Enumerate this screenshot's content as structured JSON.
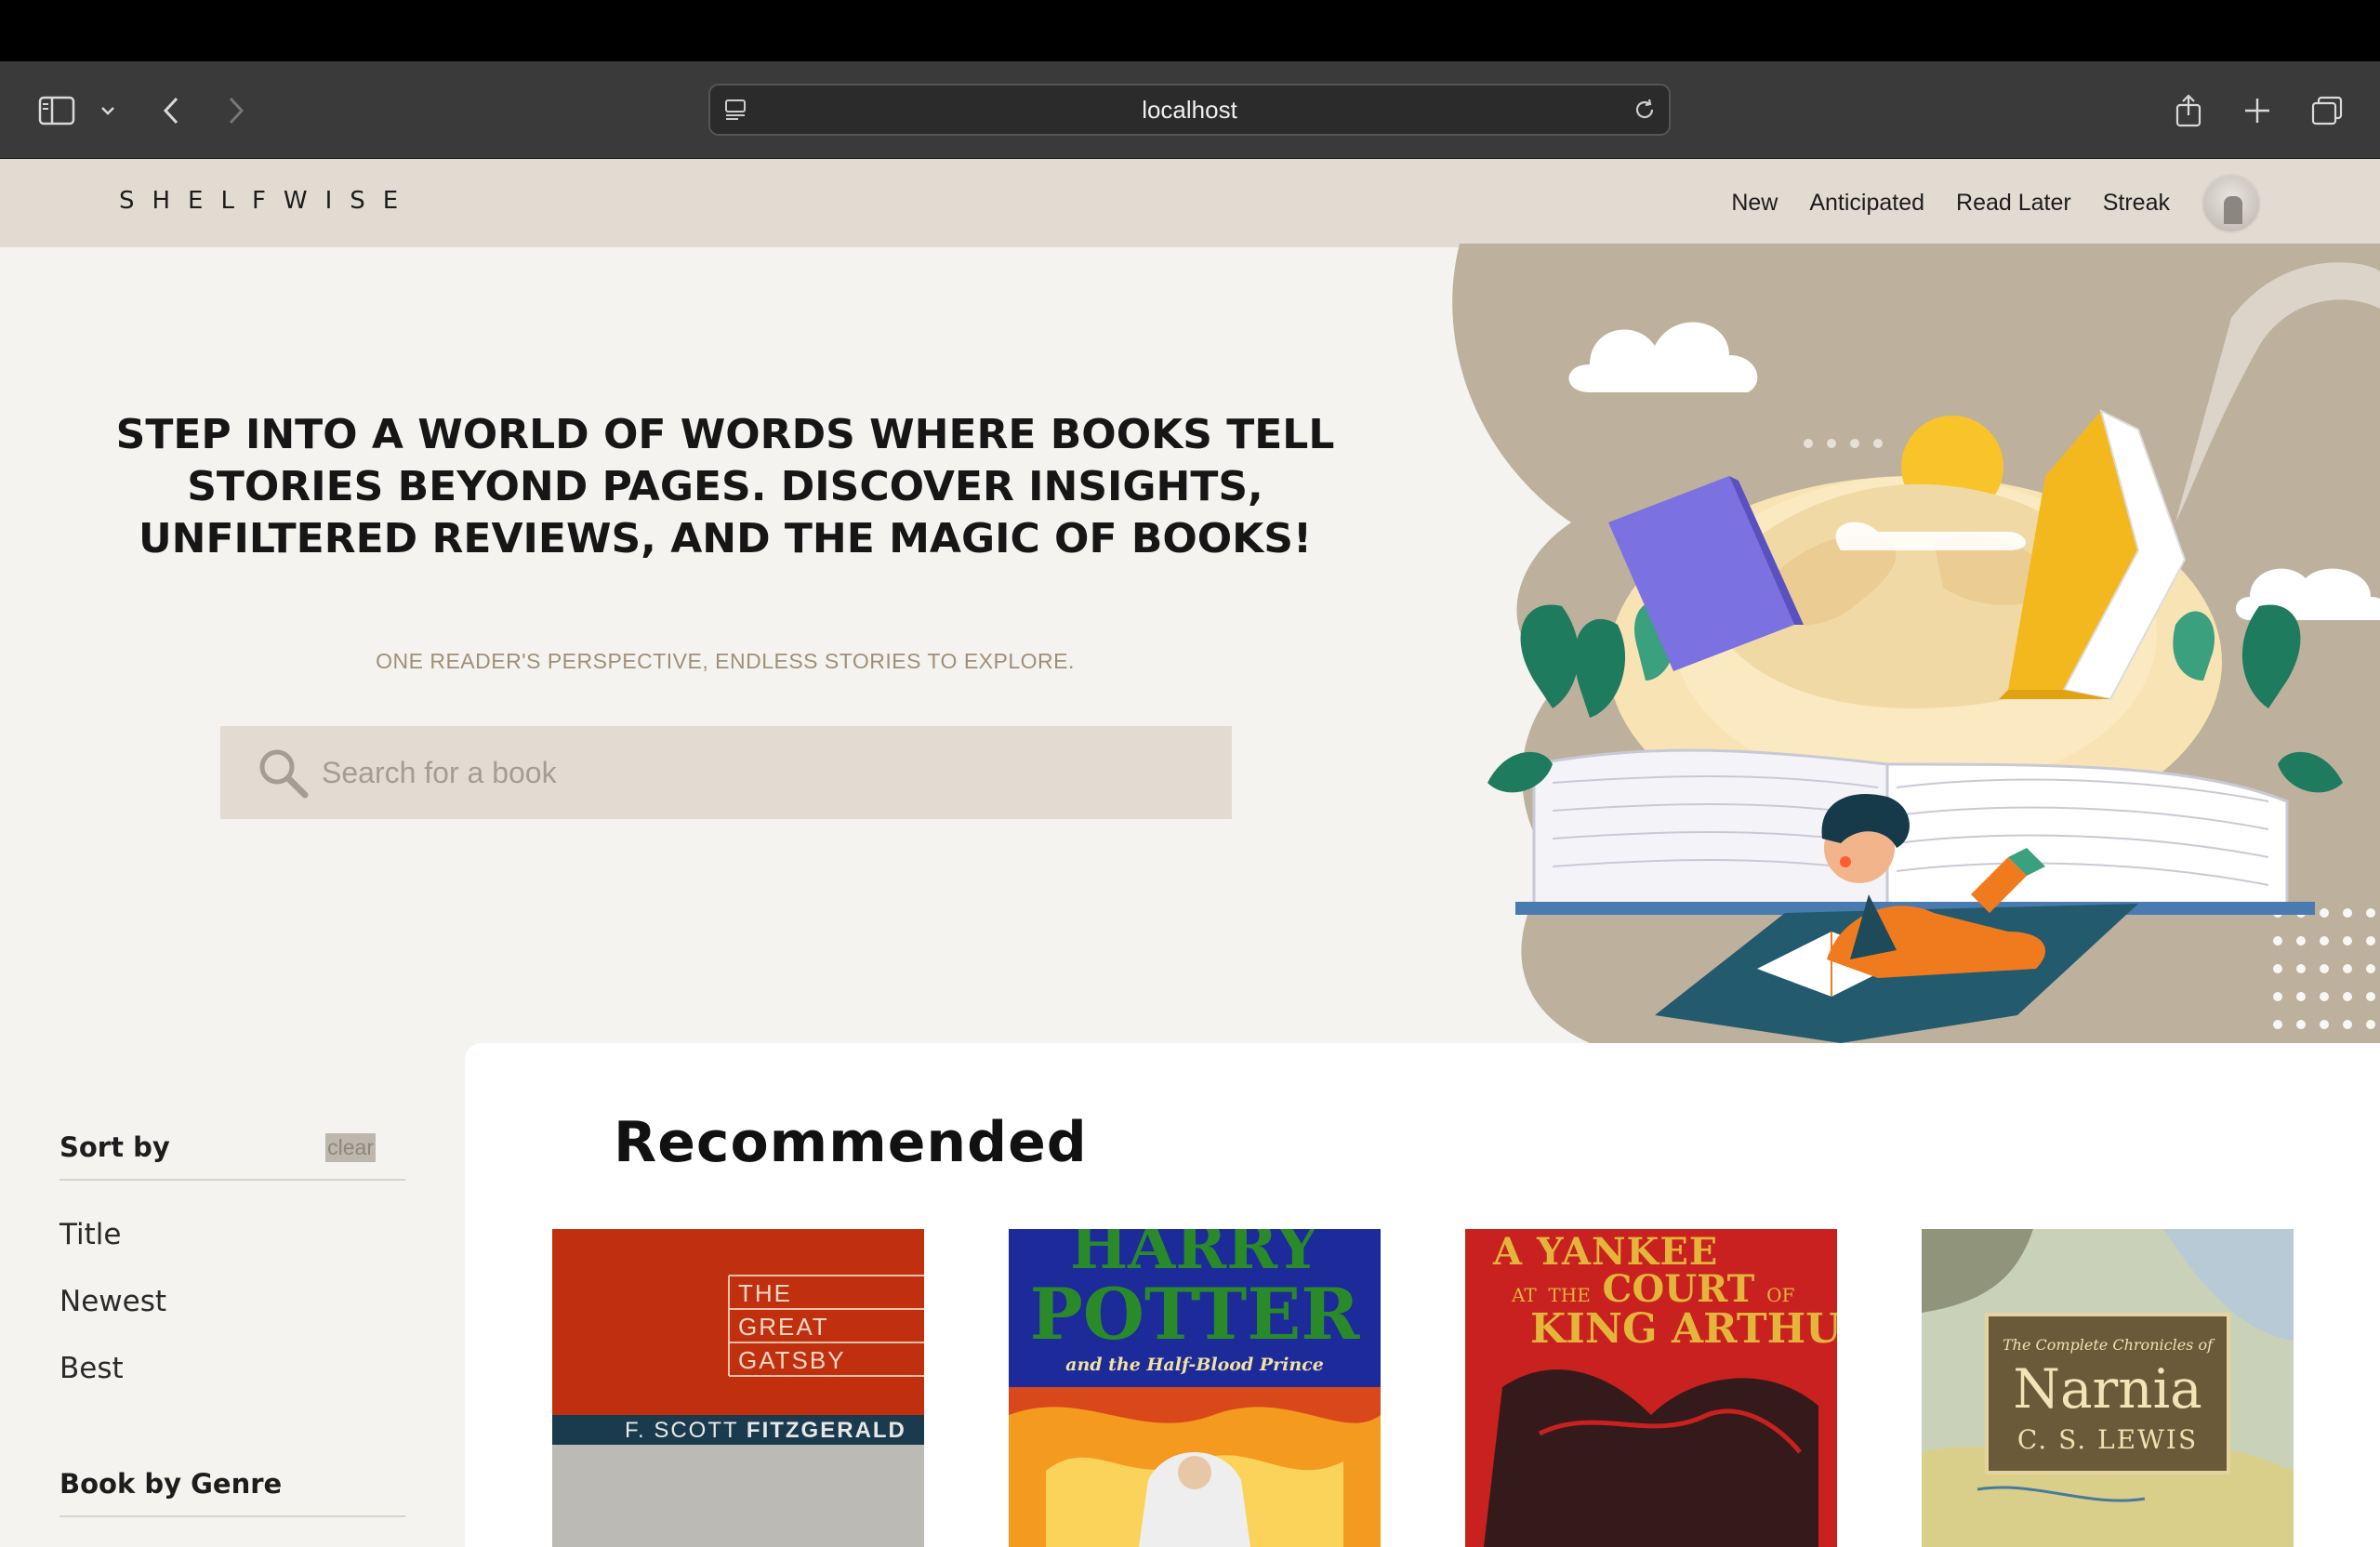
{
  "browser": {
    "url": "localhost"
  },
  "nav": {
    "logo": "SHELFWISE",
    "links": [
      "New",
      "Anticipated",
      "Read Later",
      "Streak"
    ]
  },
  "hero": {
    "title": "STEP INTO A WORLD OF WORDS WHERE BOOKS TELL STORIES BEYOND PAGES. DISCOVER INSIGHTS, UNFILTERED REVIEWS, AND THE MAGIC OF BOOKS!",
    "subtitle": "ONE READER'S PERSPECTIVE, ENDLESS STORIES TO EXPLORE.",
    "search_placeholder": "Search for a book"
  },
  "sidebar": {
    "sort_heading": "Sort by",
    "clear_label": "clear",
    "sort_options": [
      "Title",
      "Newest",
      "Best"
    ],
    "genre_heading": "Book by Genre"
  },
  "main": {
    "section_title": "Recommended",
    "books": [
      {
        "title_lines": [
          "THE",
          "GREAT",
          "GATSBY"
        ],
        "author_plain": "F. SCOTT ",
        "author_bold": "FITZGERALD"
      },
      {
        "title_top": "HARRY",
        "title_main": "POTTER",
        "subtitle": "and the Half-Blood Prince"
      },
      {
        "line1": "A YANKEE",
        "line2a": "AT",
        "line2b": "THE",
        "line2c": "COURT",
        "line2d": "OF",
        "line3": "KING ARTHUR"
      },
      {
        "small": "The Complete Chronicles of",
        "title": "Narnia",
        "author": "C. S. LEWIS"
      }
    ]
  }
}
